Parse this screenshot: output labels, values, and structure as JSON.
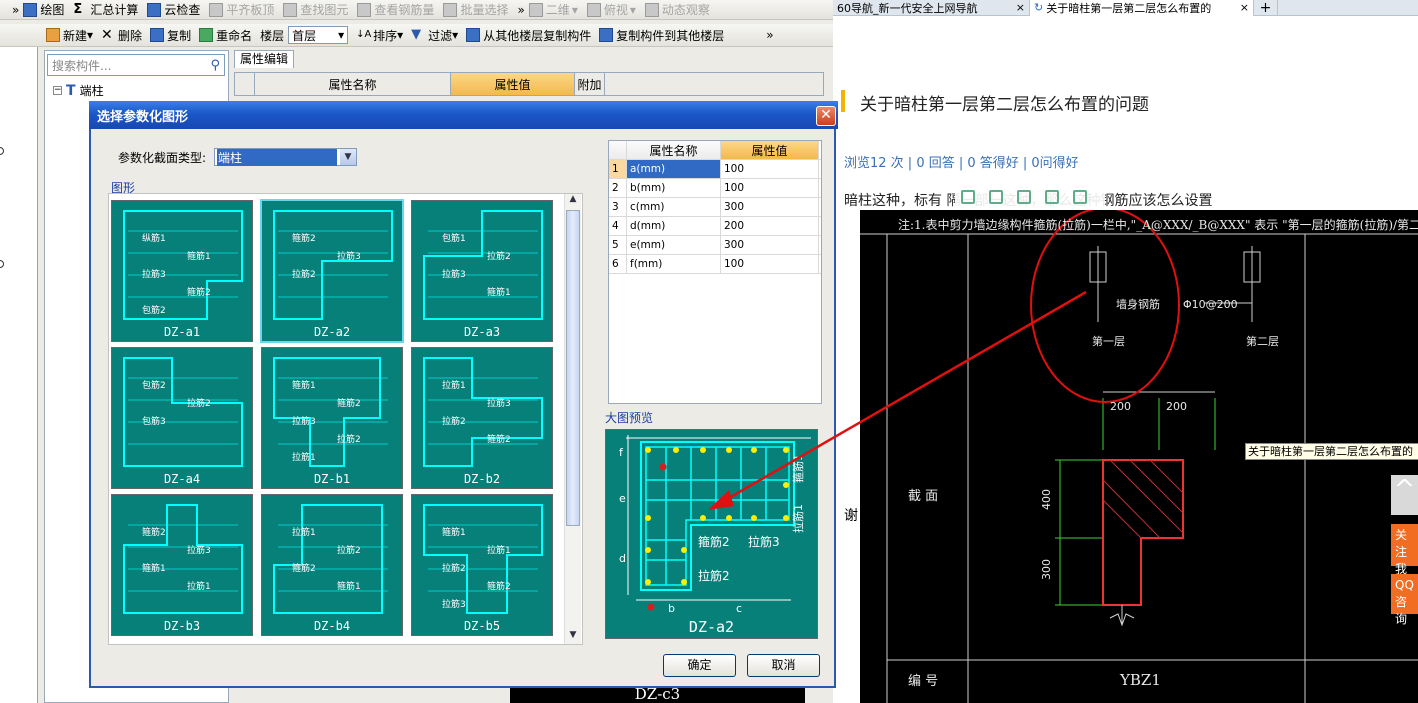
{
  "toolbar_top": {
    "more": "»",
    "draw": "绘图",
    "sum": "汇总计算",
    "cloud": "云检查",
    "flat": "平齐板顶",
    "find": "查找图元",
    "rebar": "查看钢筋量",
    "batch": "批量选择",
    "view2d": "二维",
    "topview": "俯视",
    "dynamic": "动态观察"
  },
  "toolbar_second": {
    "pin": "₽ ×",
    "new": "新建",
    "delete": "删除",
    "copy": "复制",
    "rename": "重命名",
    "floor_label": "楼层",
    "floor_value": "首层",
    "sort": "排序",
    "filter": "过滤",
    "copy_from": "从其他楼层复制构件",
    "copy_to": "复制构件到其他楼层"
  },
  "tree": {
    "search_placeholder": "搜索构件...",
    "root": "端柱"
  },
  "prop_panel": {
    "tab": "属性编辑",
    "col_name": "属性名称",
    "col_value": "属性值",
    "col_extra": "附加"
  },
  "background_text": "DZ-c3",
  "dialog": {
    "title": "选择参数化图形",
    "close": "✕",
    "type_label": "参数化截面类型:",
    "type_value": "端柱",
    "shapes_group": "图形",
    "shapes": [
      {
        "id": "DZ-a1",
        "labels": [
          "纵筋1",
          "箍筋1",
          "拉筋3",
          "箍筋2",
          "包筋2"
        ]
      },
      {
        "id": "DZ-a2",
        "labels": [
          "箍筋2",
          "拉筋3",
          "拉筋2"
        ]
      },
      {
        "id": "DZ-a3",
        "labels": [
          "包筋1",
          "拉筋2",
          "拉筋3",
          "箍筋1"
        ]
      },
      {
        "id": "DZ-a4",
        "labels": [
          "包筋2",
          "拉筋2",
          "包筋3"
        ]
      },
      {
        "id": "DZ-b1",
        "labels": [
          "箍筋1",
          "箍筋2",
          "拉筋3",
          "拉筋2",
          "拉筋1"
        ]
      },
      {
        "id": "DZ-b2",
        "labels": [
          "拉筋1",
          "拉筋3",
          "拉筋2",
          "箍筋2"
        ]
      },
      {
        "id": "DZ-b3",
        "labels": [
          "箍筋2",
          "拉筋3",
          "箍筋1",
          "拉筋1"
        ]
      },
      {
        "id": "DZ-b4",
        "labels": [
          "拉筋1",
          "拉筋2",
          "箍筋2",
          "箍筋1"
        ]
      },
      {
        "id": "DZ-b5",
        "labels": [
          "箍筋1",
          "拉筋1",
          "拉筋2",
          "箍筋2",
          "拉筋3"
        ]
      }
    ],
    "selected_shape": "DZ-a2",
    "params_header": {
      "name": "属性名称",
      "value": "属性值"
    },
    "params": [
      {
        "idx": "1",
        "name": "a(mm)",
        "value": "100"
      },
      {
        "idx": "2",
        "name": "b(mm)",
        "value": "100"
      },
      {
        "idx": "3",
        "name": "c(mm)",
        "value": "300"
      },
      {
        "idx": "4",
        "name": "d(mm)",
        "value": "200"
      },
      {
        "idx": "5",
        "name": "e(mm)",
        "value": "300"
      },
      {
        "idx": "6",
        "name": "f(mm)",
        "value": "100"
      }
    ],
    "preview_label": "大图预览",
    "preview": {
      "name": "DZ-a2",
      "labels": [
        "箍筋1",
        "拉筋1",
        "箍筋2",
        "拉筋3",
        "拉筋2"
      ],
      "dims": [
        "f",
        "e",
        "d",
        "b",
        "c"
      ]
    },
    "ok": "确定",
    "cancel": "取消"
  },
  "browser": {
    "tabs": [
      {
        "title": "60导航_新一代安全上网导航",
        "close": "×"
      },
      {
        "title": "关于暗柱第一层第二层怎么布置的",
        "close": "×"
      }
    ],
    "new_tab": "+",
    "question_title": "关于暗柱第一层第二层怎么布置的问题",
    "stats": "浏览12 次 | 0 回答 | 0 答得好 | 0问得好",
    "question_text": "暗柱这种，标有                隔一部一这种，那么这种钢筋应该怎么设置",
    "thanks": "谢",
    "tooltip": "关于暗柱第一层第二层怎么布置的",
    "side_buttons": {
      "top": "^",
      "follow": "关注我们",
      "qq": "QQ咨询"
    },
    "cad": {
      "note": "注:1.表中剪力墙边缘构件箍筋(拉筋)一栏中,\"_A@XXX/_B@XXX\" 表示 \"第一层的箍筋(拉筋)/第二层的",
      "wall_rebar": "墙身钢筋",
      "layer1": "第一层",
      "layer2": "第二层",
      "spacing": "Φ10@200",
      "dim_top": [
        "200",
        "200"
      ],
      "dim_side": [
        "400",
        "300"
      ],
      "row_section": "截  面",
      "row_number": "编  号",
      "component_id": "YBZ1"
    }
  }
}
